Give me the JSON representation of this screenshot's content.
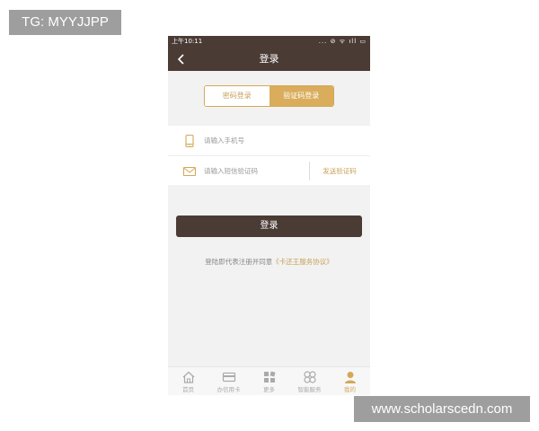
{
  "watermarks": {
    "top_left": "TG: MYYJJPP",
    "bottom_right": "www.scholarscedn.com"
  },
  "status_bar": {
    "time": "上午10:11",
    "icons": "... ⊘ ᯤ ıll ▭"
  },
  "nav": {
    "title": "登录",
    "back_icon": "chevron-left-icon"
  },
  "tabs": [
    {
      "label": "密码登录",
      "active": false
    },
    {
      "label": "验证码登录",
      "active": true
    }
  ],
  "form": {
    "phone": {
      "placeholder": "请输入手机号",
      "value": "",
      "icon": "phone-icon"
    },
    "code": {
      "placeholder": "请输入短信验证码",
      "value": "",
      "icon": "envelope-icon"
    },
    "send_code_label": "发送验证码"
  },
  "login_button": {
    "label": "登录"
  },
  "agreement": {
    "prefix": "登陆即代表注册并同意",
    "link": "《卡还王服务协议》"
  },
  "bottom_tabs": [
    {
      "label": "首页",
      "icon": "home-icon",
      "active": false
    },
    {
      "label": "办信用卡",
      "icon": "credit-card-icon",
      "active": false
    },
    {
      "label": "更多",
      "icon": "grid-icon",
      "active": false
    },
    {
      "label": "智能服务",
      "icon": "clover-icon",
      "active": false
    },
    {
      "label": "我的",
      "icon": "user-icon",
      "active": true
    }
  ],
  "colors": {
    "header_brown": "#4a3b35",
    "accent_gold": "#d9ad5c",
    "background": "#f2f2f2"
  }
}
